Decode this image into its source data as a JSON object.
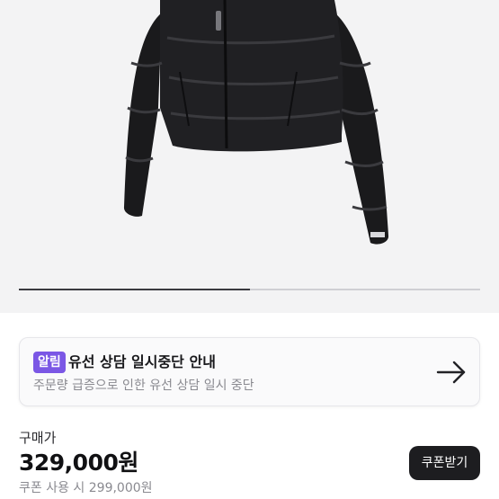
{
  "product": {
    "image_alt": "black puffer jacket",
    "carousel_progress": 0.5
  },
  "notice": {
    "badge": "알림",
    "title": "유선 상담 일시중단 안내",
    "subtitle": "주문량 급증으로 인한 유선 상담 일시 중단",
    "icon": "arrow-right-icon"
  },
  "pricing": {
    "label": "구매가",
    "price": "329,000원",
    "coupon_price": "쿠폰 사용 시 299,000원",
    "coupon_button": "쿠폰받기"
  },
  "colors": {
    "accent": "#7b57e5",
    "button": "#1d1d20",
    "image_bg": "#f3f3f4"
  }
}
